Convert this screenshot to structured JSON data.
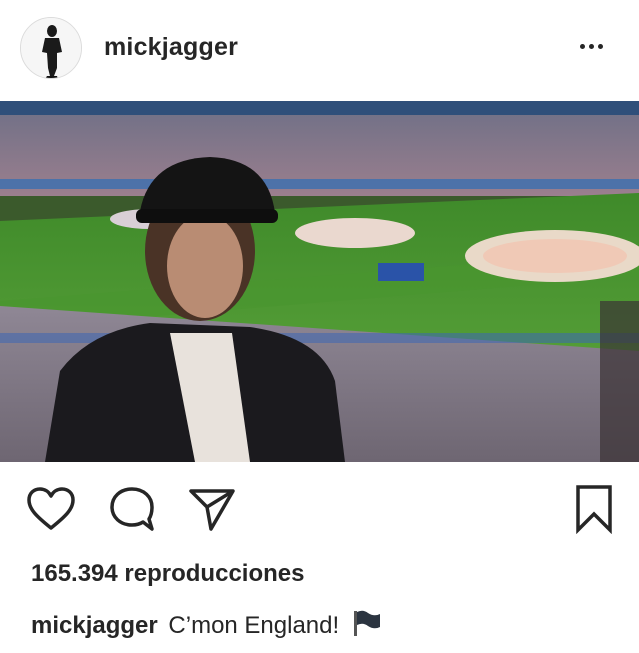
{
  "post": {
    "username": "mickjagger",
    "views": "165.394 reproducciones",
    "caption_user": "mickjagger",
    "caption_text": "C’mon England!",
    "caption_emoji": "black-flag"
  },
  "icons": {
    "more": "more-options-icon",
    "like": "heart-icon",
    "comment": "comment-icon",
    "share": "paper-plane-icon",
    "save": "bookmark-icon"
  },
  "colors": {
    "text": "#262626",
    "border": "#dbdbdb",
    "pitch": "#4f8a2e"
  }
}
